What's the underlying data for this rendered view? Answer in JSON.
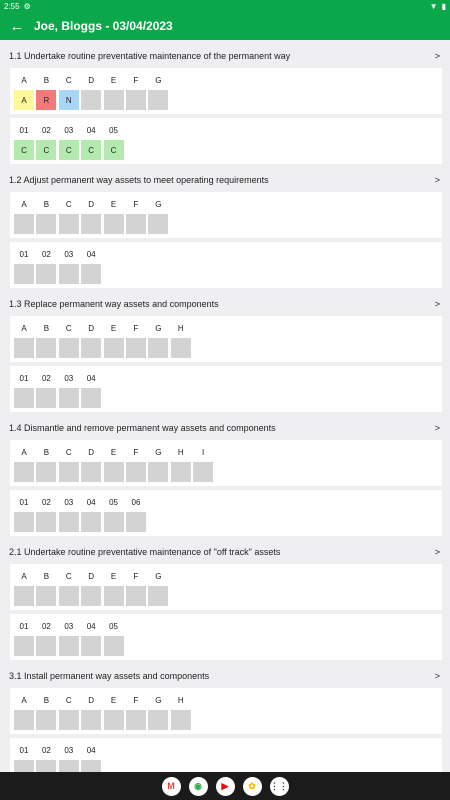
{
  "status_bar": {
    "time": "2:55"
  },
  "app_bar": {
    "back_icon": "arrow-left-icon",
    "title": "Joe, Bloggs - 03/04/2023"
  },
  "colors": {
    "green": "#0aa84a",
    "yellow": "#fff89a",
    "red": "#f47a7a",
    "blue": "#a9d6f7",
    "lightgreen": "#b4eab0",
    "grey": "#d3d3d3"
  },
  "sections": [
    {
      "title": "1.1 Undertake routine preventative maintenance of the permanent way",
      "rowA": [
        {
          "label": "A",
          "value": "A",
          "color": "yellow"
        },
        {
          "label": "B",
          "value": "R",
          "color": "red"
        },
        {
          "label": "C",
          "value": "N",
          "color": "blue"
        },
        {
          "label": "D",
          "value": "",
          "color": "grey"
        },
        {
          "label": "E",
          "value": "",
          "color": "grey"
        },
        {
          "label": "F",
          "value": "",
          "color": "grey"
        },
        {
          "label": "G",
          "value": "",
          "color": "grey"
        }
      ],
      "rowB": [
        {
          "label": "01",
          "value": "C",
          "color": "lightgreen"
        },
        {
          "label": "02",
          "value": "C",
          "color": "lightgreen"
        },
        {
          "label": "03",
          "value": "C",
          "color": "lightgreen"
        },
        {
          "label": "04",
          "value": "C",
          "color": "lightgreen"
        },
        {
          "label": "05",
          "value": "C",
          "color": "lightgreen"
        }
      ]
    },
    {
      "title": "1.2 Adjust permanent way assets to meet operating requirements",
      "rowA": [
        {
          "label": "A",
          "value": "",
          "color": "grey"
        },
        {
          "label": "B",
          "value": "",
          "color": "grey"
        },
        {
          "label": "C",
          "value": "",
          "color": "grey"
        },
        {
          "label": "D",
          "value": "",
          "color": "grey"
        },
        {
          "label": "E",
          "value": "",
          "color": "grey"
        },
        {
          "label": "F",
          "value": "",
          "color": "grey"
        },
        {
          "label": "G",
          "value": "",
          "color": "grey"
        }
      ],
      "rowB": [
        {
          "label": "01",
          "value": "",
          "color": "grey"
        },
        {
          "label": "02",
          "value": "",
          "color": "grey"
        },
        {
          "label": "03",
          "value": "",
          "color": "grey"
        },
        {
          "label": "04",
          "value": "",
          "color": "grey"
        }
      ]
    },
    {
      "title": "1.3 Replace permanent way assets and components",
      "rowA": [
        {
          "label": "A",
          "value": "",
          "color": "grey"
        },
        {
          "label": "B",
          "value": "",
          "color": "grey"
        },
        {
          "label": "C",
          "value": "",
          "color": "grey"
        },
        {
          "label": "D",
          "value": "",
          "color": "grey"
        },
        {
          "label": "E",
          "value": "",
          "color": "grey"
        },
        {
          "label": "F",
          "value": "",
          "color": "grey"
        },
        {
          "label": "G",
          "value": "",
          "color": "grey"
        },
        {
          "label": "H",
          "value": "",
          "color": "grey"
        }
      ],
      "rowB": [
        {
          "label": "01",
          "value": "",
          "color": "grey"
        },
        {
          "label": "02",
          "value": "",
          "color": "grey"
        },
        {
          "label": "03",
          "value": "",
          "color": "grey"
        },
        {
          "label": "04",
          "value": "",
          "color": "grey"
        }
      ]
    },
    {
      "title": "1.4 Dismantle and remove permanent way assets and components",
      "rowA": [
        {
          "label": "A",
          "value": "",
          "color": "grey"
        },
        {
          "label": "B",
          "value": "",
          "color": "grey"
        },
        {
          "label": "C",
          "value": "",
          "color": "grey"
        },
        {
          "label": "D",
          "value": "",
          "color": "grey"
        },
        {
          "label": "E",
          "value": "",
          "color": "grey"
        },
        {
          "label": "F",
          "value": "",
          "color": "grey"
        },
        {
          "label": "G",
          "value": "",
          "color": "grey"
        },
        {
          "label": "H",
          "value": "",
          "color": "grey"
        },
        {
          "label": "I",
          "value": "",
          "color": "grey"
        }
      ],
      "rowB": [
        {
          "label": "01",
          "value": "",
          "color": "grey"
        },
        {
          "label": "02",
          "value": "",
          "color": "grey"
        },
        {
          "label": "03",
          "value": "",
          "color": "grey"
        },
        {
          "label": "04",
          "value": "",
          "color": "grey"
        },
        {
          "label": "05",
          "value": "",
          "color": "grey"
        },
        {
          "label": "06",
          "value": "",
          "color": "grey"
        }
      ]
    },
    {
      "title": "2.1 Undertake routine preventative maintenance of \"off track\" assets",
      "rowA": [
        {
          "label": "A",
          "value": "",
          "color": "grey"
        },
        {
          "label": "B",
          "value": "",
          "color": "grey"
        },
        {
          "label": "C",
          "value": "",
          "color": "grey"
        },
        {
          "label": "D",
          "value": "",
          "color": "grey"
        },
        {
          "label": "E",
          "value": "",
          "color": "grey"
        },
        {
          "label": "F",
          "value": "",
          "color": "grey"
        },
        {
          "label": "G",
          "value": "",
          "color": "grey"
        }
      ],
      "rowB": [
        {
          "label": "01",
          "value": "",
          "color": "grey"
        },
        {
          "label": "02",
          "value": "",
          "color": "grey"
        },
        {
          "label": "03",
          "value": "",
          "color": "grey"
        },
        {
          "label": "04",
          "value": "",
          "color": "grey"
        },
        {
          "label": "05",
          "value": "",
          "color": "grey"
        }
      ]
    },
    {
      "title": "3.1 Install permanent way assets and components",
      "rowA": [
        {
          "label": "A",
          "value": "",
          "color": "grey"
        },
        {
          "label": "B",
          "value": "",
          "color": "grey"
        },
        {
          "label": "C",
          "value": "",
          "color": "grey"
        },
        {
          "label": "D",
          "value": "",
          "color": "grey"
        },
        {
          "label": "E",
          "value": "",
          "color": "grey"
        },
        {
          "label": "F",
          "value": "",
          "color": "grey"
        },
        {
          "label": "G",
          "value": "",
          "color": "grey"
        },
        {
          "label": "H",
          "value": "",
          "color": "grey"
        }
      ],
      "rowB": [
        {
          "label": "01",
          "value": "",
          "color": "grey"
        },
        {
          "label": "02",
          "value": "",
          "color": "grey"
        },
        {
          "label": "03",
          "value": "",
          "color": "grey"
        },
        {
          "label": "04",
          "value": "",
          "color": "grey"
        }
      ]
    }
  ],
  "nav_apps": [
    {
      "name": "gmail-icon",
      "glyph": "M",
      "color": "#ea4335"
    },
    {
      "name": "chrome-icon",
      "glyph": "◉",
      "color": "#34a853"
    },
    {
      "name": "youtube-icon",
      "glyph": "▶",
      "color": "#ff0000"
    },
    {
      "name": "photos-icon",
      "glyph": "✿",
      "color": "#fbbc05"
    },
    {
      "name": "app-drawer-icon",
      "glyph": "⋮⋮",
      "color": "#444444"
    }
  ]
}
